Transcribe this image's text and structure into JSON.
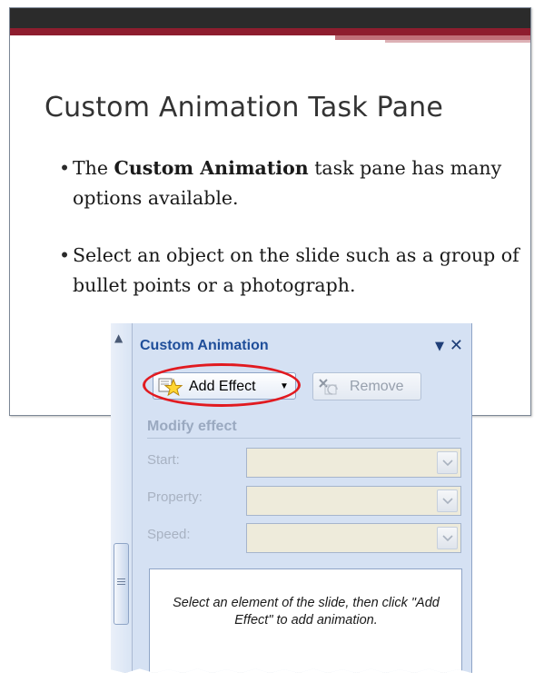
{
  "slide": {
    "title": "Custom Animation Task Pane",
    "bullets": [
      {
        "before": "The ",
        "bold": "Custom Animation",
        "after": " task pane has many options available."
      },
      {
        "before": "Select an object on the slide such as a group of bullet points or a photograph.",
        "bold": "",
        "after": ""
      }
    ]
  },
  "task_pane": {
    "title": "Custom Animation",
    "add_effect_label": "Add Effect",
    "remove_label": "Remove",
    "modify_group_label": "Modify effect",
    "fields": [
      {
        "label": "Start:",
        "value": ""
      },
      {
        "label": "Property:",
        "value": ""
      },
      {
        "label": "Speed:",
        "value": ""
      }
    ],
    "info_text": "Select an element of the slide, then click \"Add Effect\" to add animation.",
    "menu_icon": "dropdown-triangle-icon",
    "close_icon": "close-icon"
  },
  "colors": {
    "slide_top_bar": "#2b2b2b",
    "slide_accent": "#8e1d2e",
    "pane_background": "#d5e1f3",
    "pane_title": "#1f4e9a",
    "highlight": "#e11a20",
    "disabled_text": "#a8b2c2"
  }
}
